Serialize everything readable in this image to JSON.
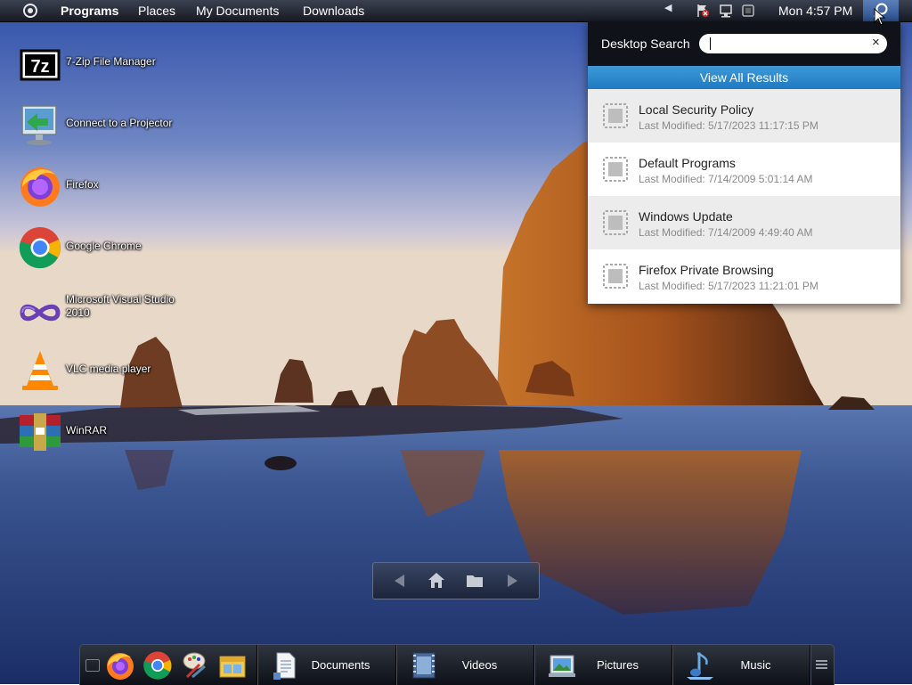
{
  "menubar": {
    "items": [
      {
        "label": "Programs",
        "bold": true
      },
      {
        "label": "Places"
      },
      {
        "label": "My Documents"
      },
      {
        "label": "Downloads"
      }
    ],
    "clock": "Mon 4:57 PM"
  },
  "desktop": {
    "icons": [
      {
        "label": "7-Zip File Manager",
        "icon": "7zip-icon"
      },
      {
        "label": "Connect to a Projector",
        "icon": "projector-icon"
      },
      {
        "label": "Firefox",
        "icon": "firefox-icon"
      },
      {
        "label": "Google Chrome",
        "icon": "chrome-icon"
      },
      {
        "label": "Microsoft Visual Studio 2010",
        "icon": "visual-studio-icon"
      },
      {
        "label": "VLC media player",
        "icon": "vlc-icon"
      },
      {
        "label": "WinRAR",
        "icon": "winrar-icon"
      }
    ]
  },
  "search": {
    "title": "Desktop Search",
    "query": "",
    "clear_glyph": "×",
    "view_all": "View All Results",
    "results": [
      {
        "name": "Local Security Policy",
        "modified": "Last Modified: 5/17/2023 11:17:15 PM"
      },
      {
        "name": "Default Programs",
        "modified": "Last Modified: 7/14/2009 5:01:14 AM"
      },
      {
        "name": "Windows Update",
        "modified": "Last Modified: 7/14/2009 4:49:40 AM"
      },
      {
        "name": "Firefox Private Browsing",
        "modified": "Last Modified: 5/17/2023 11:21:01 PM"
      }
    ]
  },
  "dock": {
    "apps": [
      "firefox-icon",
      "chrome-icon",
      "paint-icon",
      "file-manager-icon"
    ],
    "libraries": [
      {
        "label": "Documents",
        "icon": "documents-icon"
      },
      {
        "label": "Videos",
        "icon": "videos-icon"
      },
      {
        "label": "Pictures",
        "icon": "pictures-icon"
      },
      {
        "label": "Music",
        "icon": "music-icon"
      }
    ]
  }
}
